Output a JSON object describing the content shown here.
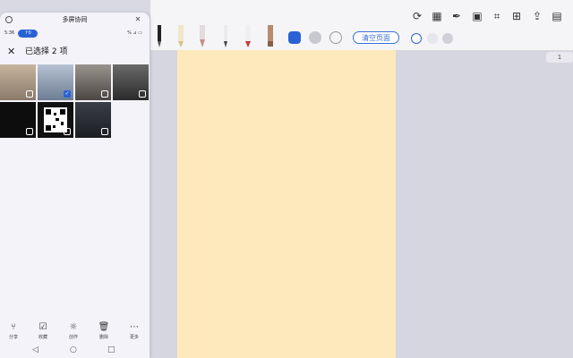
{
  "window": {
    "title": "多屏协同"
  },
  "status": {
    "time": "5:36",
    "pill": "↑0",
    "right": "% ⊿ ▭"
  },
  "selection": {
    "title": "已选择 2 项"
  },
  "actions": [
    {
      "icon": "share-icon",
      "label": "分享"
    },
    {
      "icon": "favorite-icon",
      "label": "收藏"
    },
    {
      "icon": "bulb-icon",
      "label": "创作"
    },
    {
      "icon": "trash-icon",
      "label": "删除"
    },
    {
      "icon": "more-icon",
      "label": "更多"
    }
  ],
  "toolbar": {
    "clear_label": "清空页面",
    "page_chip": "1"
  },
  "photos": [
    {
      "checked": false,
      "tone": "#a89886"
    },
    {
      "checked": true,
      "tone": "#8795ab"
    },
    {
      "checked": false,
      "tone": "#6f6a66"
    },
    {
      "checked": false,
      "tone": "#3d3d3d"
    },
    {
      "checked": true,
      "tone": "#3c3c3c"
    },
    {
      "checked": false,
      "tone": "#111111"
    },
    {
      "checked": false,
      "tone": "#ffffff"
    },
    {
      "checked": false,
      "tone": "#2a2d33"
    }
  ],
  "colors": {
    "accent": "#2a62d6",
    "paper": "#fde9bb",
    "canvas": "#d6d6e0"
  }
}
